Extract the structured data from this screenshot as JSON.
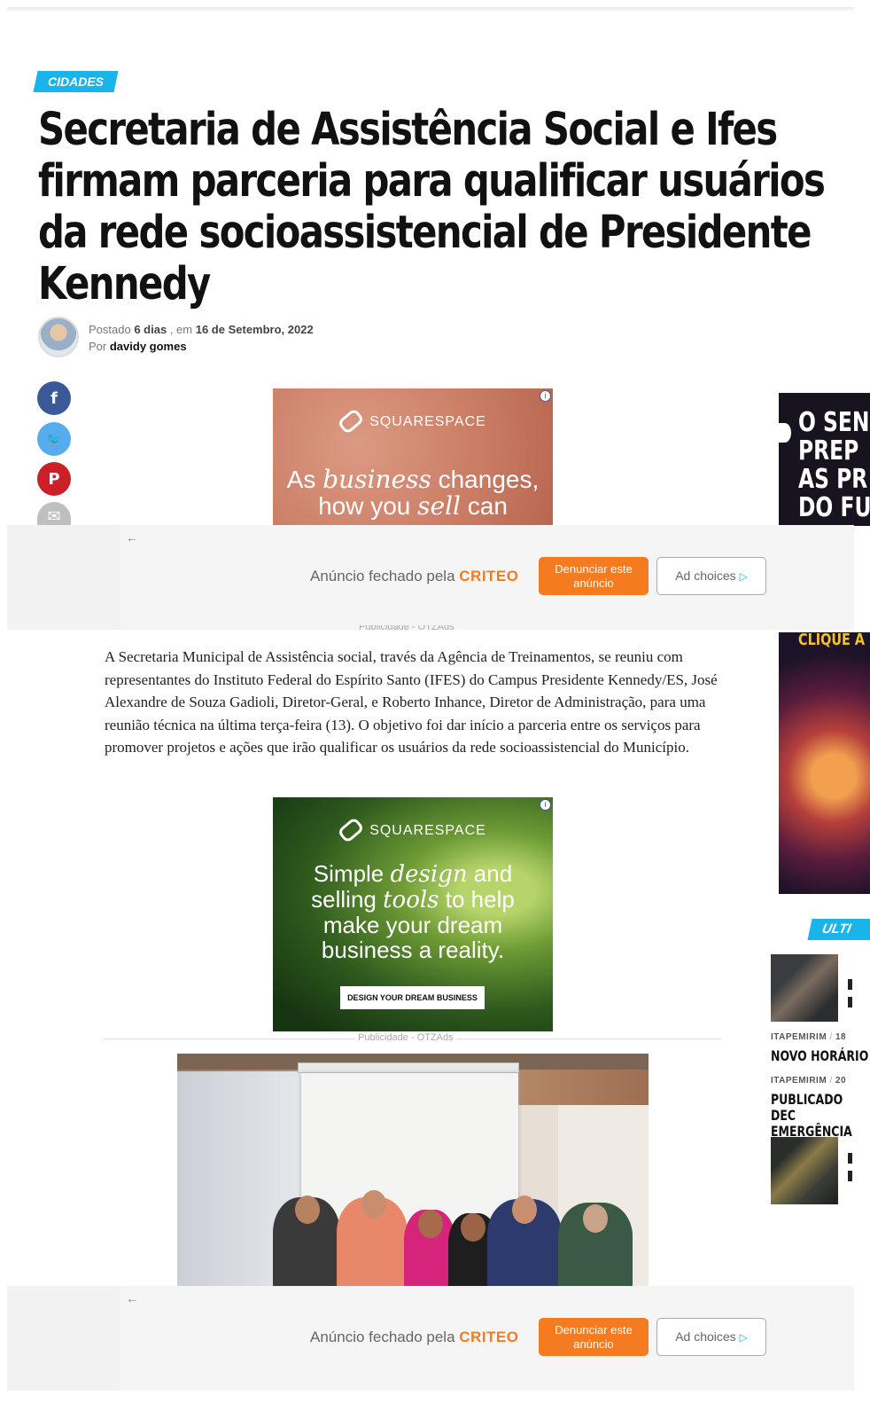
{
  "category": "CIDADES",
  "headline": "Secretaria de Assistência Social e Ifes firmam parceria para qualificar usuários da rede socioassistencial de Presidente Kennedy",
  "meta": {
    "posted_prefix": "Postado",
    "posted_ago": "6 dias",
    "posted_mid": ", em",
    "date": "16 de Setembro, 2022",
    "by_prefix": "Por",
    "author": "davidy gomes"
  },
  "share": {
    "facebook_icon": "f",
    "twitter_icon": "🐦",
    "pinterest_icon": "P",
    "email_icon": "✉",
    "colors": {
      "facebook": "#3b5998",
      "twitter": "#55acee",
      "pinterest": "#cb2027",
      "email": "#bfbfbf"
    }
  },
  "ad_top": {
    "brand": "SQUARESPACE",
    "line1_pre": "As ",
    "line1_em": "business",
    "line1_post": " changes,",
    "line2_pre": "how you ",
    "line2_em": "sell",
    "line2_post": " can"
  },
  "criteo_bar": {
    "back_arrow": "←",
    "closed_prefix": "Anúncio fechado pela",
    "criteo": "CRITEO",
    "report_button": "Denunciar este anúncio",
    "ad_choices": "Ad choices",
    "ad_choices_icon": "▷"
  },
  "pub_mini": "Publicidade - OTZAds",
  "body_text": "A Secretaria Municipal de Assistência social, través da Agência de Treinamentos, se reuniu com representantes do Instituto Federal do Espírito Santo (IFES) do Campus Presidente Kennedy/ES, José Alexandre de Souza Gadioli, Diretor-Geral, e Roberto Inhance, Diretor de Administração, para uma reunião técnica na última terça-feira (13). O objetivo foi dar início a parceria entre os serviços para promover projetos e ações que irão qualificar os usuários da rede socioassistencial do Município.",
  "ad_mid": {
    "brand": "SQUARESPACE",
    "l1_pre": "Simple ",
    "l1_em": "design",
    "l1_post": " and",
    "l2_pre": "selling ",
    "l2_em": "tools",
    "l2_post": " to help",
    "l3": "make your dream",
    "l4": "business a reality.",
    "cta": "DESIGN YOUR DREAM BUSINESS"
  },
  "publicidade": "Publicidade - OTZAds",
  "right_ad_top": "O SEN PREP AS PR DO FU",
  "right_ad_bottom": "CLIQUE A",
  "sidebar": {
    "section": "ULTI",
    "items": [
      {
        "tag": "ITAPEMIRIM",
        "date": "18",
        "title": "NOVO HORÁRIO"
      },
      {
        "tag": "ITAPEMIRIM",
        "date": "20",
        "title": "PUBLICADO DEC EMERGÊNCIA"
      }
    ]
  }
}
